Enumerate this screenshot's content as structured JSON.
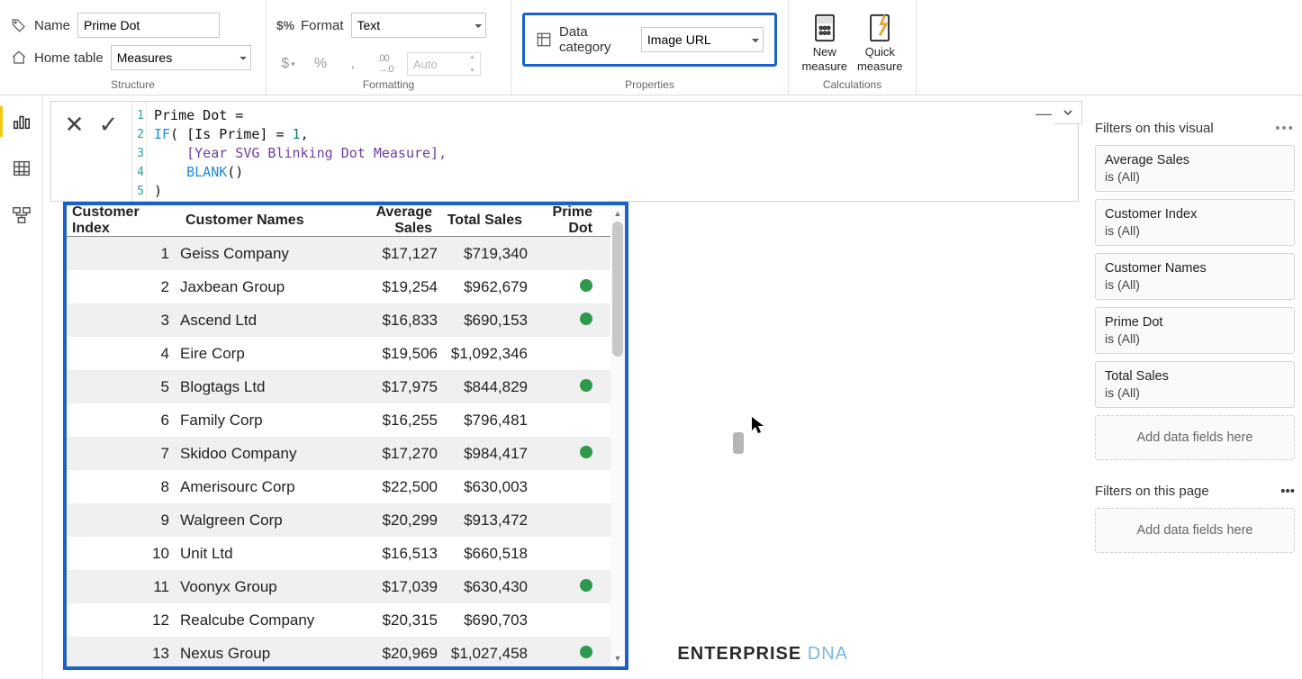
{
  "ribbon": {
    "structure": {
      "label": "Structure",
      "name_label": "Name",
      "name_value": "Prime Dot",
      "home_label": "Home table",
      "home_value": "Measures"
    },
    "formatting": {
      "label": "Formatting",
      "format_label": "Format",
      "format_value": "Text",
      "auto_placeholder": "Auto"
    },
    "properties": {
      "label": "Properties",
      "dc_label": "Data category",
      "dc_value": "Image URL"
    },
    "calculations": {
      "label": "Calculations",
      "new_measure": "New measure",
      "quick_measure": "Quick measure"
    }
  },
  "formula": {
    "l1": "Prime Dot =",
    "l2a": "IF",
    "l2b": "( [Is Prime] = ",
    "l2num": "1",
    "l2c": ",",
    "l3": "    [Year SVG Blinking Dot Measure],",
    "l4a": "    ",
    "l4b": "BLANK",
    "l4c": "()",
    "l5": ")"
  },
  "table": {
    "cols": [
      "Customer Index",
      "Customer Names",
      "Average Sales",
      "Total Sales",
      "Prime Dot"
    ],
    "rows": [
      {
        "idx": "1",
        "name": "Geiss Company",
        "avg": "$17,127",
        "tot": "$719,340",
        "dot": false
      },
      {
        "idx": "2",
        "name": "Jaxbean Group",
        "avg": "$19,254",
        "tot": "$962,679",
        "dot": true
      },
      {
        "idx": "3",
        "name": "Ascend Ltd",
        "avg": "$16,833",
        "tot": "$690,153",
        "dot": true
      },
      {
        "idx": "4",
        "name": "Eire Corp",
        "avg": "$19,506",
        "tot": "$1,092,346",
        "dot": false
      },
      {
        "idx": "5",
        "name": "Blogtags Ltd",
        "avg": "$17,975",
        "tot": "$844,829",
        "dot": true
      },
      {
        "idx": "6",
        "name": "Family Corp",
        "avg": "$16,255",
        "tot": "$796,481",
        "dot": false
      },
      {
        "idx": "7",
        "name": "Skidoo Company",
        "avg": "$17,270",
        "tot": "$984,417",
        "dot": true
      },
      {
        "idx": "8",
        "name": "Amerisourc Corp",
        "avg": "$22,500",
        "tot": "$630,003",
        "dot": false
      },
      {
        "idx": "9",
        "name": "Walgreen Corp",
        "avg": "$20,299",
        "tot": "$913,472",
        "dot": false
      },
      {
        "idx": "10",
        "name": "Unit Ltd",
        "avg": "$16,513",
        "tot": "$660,518",
        "dot": false
      },
      {
        "idx": "11",
        "name": "Voonyx Group",
        "avg": "$17,039",
        "tot": "$630,430",
        "dot": true
      },
      {
        "idx": "12",
        "name": "Realcube Company",
        "avg": "$20,315",
        "tot": "$690,703",
        "dot": false
      },
      {
        "idx": "13",
        "name": "Nexus Group",
        "avg": "$20,969",
        "tot": "$1,027,458",
        "dot": true
      }
    ]
  },
  "filters": {
    "visual_header": "Filters on this visual",
    "page_header": "Filters on this page",
    "add_text": "Add data fields here",
    "is_all": "is (All)",
    "cards": [
      "Average Sales",
      "Customer Index",
      "Customer Names",
      "Prime Dot",
      "Total Sales"
    ]
  },
  "watermark": {
    "a": "ENTERPRISE ",
    "b": "DNA"
  },
  "bg": "eDN"
}
